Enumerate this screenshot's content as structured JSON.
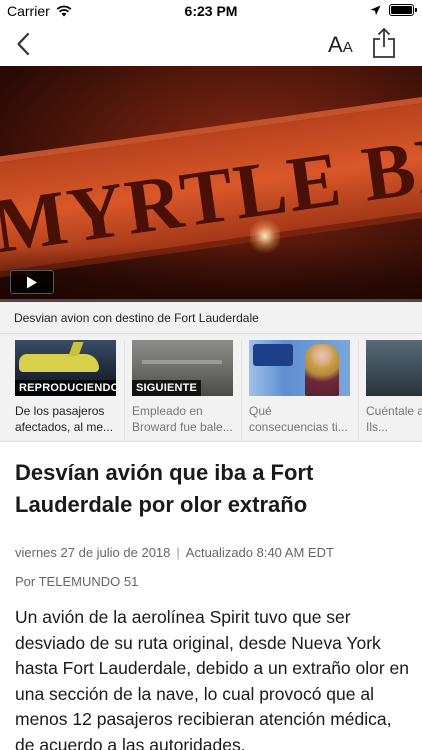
{
  "status_bar": {
    "carrier": "Carrier",
    "time": "6:23 PM"
  },
  "nav": {
    "back_icon": "chevron-left-icon",
    "font_size_label_big": "A",
    "font_size_label_small": "A",
    "share_icon": "share-icon"
  },
  "video": {
    "sign_text": "MYRTLE BEACH",
    "play_icon": "play-icon",
    "progress": 0.0
  },
  "playlist": {
    "title": "Desvian avion con destino de Fort Lauderdale",
    "cards": [
      {
        "badge": "REPRODUCIENDO",
        "caption": "De los pasajeros afectados, al me..."
      },
      {
        "badge": "SIGUIENTE",
        "caption": "Empleado en Broward fue bale..."
      },
      {
        "badge": "",
        "caption": "Qué consecuencias ti..."
      },
      {
        "badge": "",
        "caption": "Cuéntale a Marilys: Ils..."
      }
    ]
  },
  "article": {
    "headline": "Desvían avión que iba a Fort Lauderdale por olor extraño",
    "date": "viernes 27 de julio de 2018",
    "separator": "|",
    "updated": "Actualizado 8:40 AM EDT",
    "author": "Por TELEMUNDO 51",
    "body": "Un avión de la aerolínea Spirit tuvo que ser desviado de su ruta original, desde Nueva York hasta Fort Lauderdale, debido a un extraño olor en una sección de la nave, lo cual provocó que al menos 12 pasajeros recibieran atención médica, de acuerdo a las autoridades."
  },
  "colors": {
    "accent": "#e21b1b",
    "text": "#1a1a1a",
    "muted": "#666666"
  }
}
